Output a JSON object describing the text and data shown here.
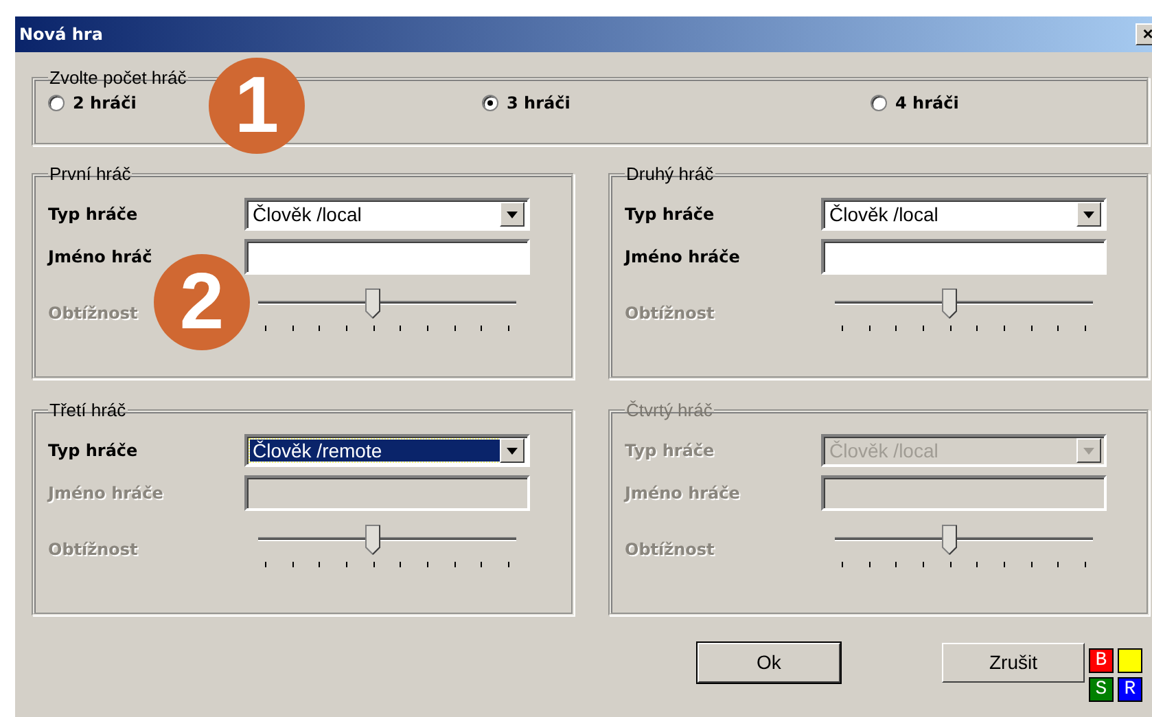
{
  "window": {
    "title": "Nová hra",
    "close": "×"
  },
  "player_count": {
    "title": "Zvolte počet hráč",
    "options": [
      {
        "label": "2 hráči",
        "selected": false
      },
      {
        "label": "3 hráči",
        "selected": true
      },
      {
        "label": "4 hráči",
        "selected": false
      }
    ]
  },
  "players": [
    {
      "title": "První hráč",
      "disabled": false,
      "type": {
        "label": "Typ hráče",
        "value": "Člověk /local",
        "highlighted": false,
        "disabled": false
      },
      "name": {
        "label": "Jméno hráč",
        "disabled": false
      },
      "difficulty": {
        "label": "Obtížnost",
        "disabled": true,
        "level": 0.44
      }
    },
    {
      "title": "Druhý hráč",
      "disabled": false,
      "type": {
        "label": "Typ hráče",
        "value": "Člověk /local",
        "highlighted": false,
        "disabled": false
      },
      "name": {
        "label": "Jméno hráče",
        "disabled": false
      },
      "difficulty": {
        "label": "Obtížnost",
        "disabled": true,
        "level": 0.44
      }
    },
    {
      "title": "Třetí hráč",
      "disabled": false,
      "type": {
        "label": "Typ hráče",
        "value": "Člověk /remote",
        "highlighted": true,
        "disabled": false
      },
      "name": {
        "label": "Jméno hráče",
        "disabled": true
      },
      "difficulty": {
        "label": "Obtížnost",
        "disabled": true,
        "level": 0.44
      }
    },
    {
      "title": "Čtvrtý hráč",
      "disabled": true,
      "type": {
        "label": "Typ hráče",
        "value": "Člověk /local",
        "highlighted": false,
        "disabled": true
      },
      "name": {
        "label": "Jméno hráče",
        "disabled": true
      },
      "difficulty": {
        "label": "Obtížnost",
        "disabled": true,
        "level": 0.44
      }
    }
  ],
  "buttons": [
    {
      "label": "Ok",
      "default": true
    },
    {
      "label": "Zrušit",
      "default": false
    }
  ],
  "logo_tiles": [
    {
      "letter": "B",
      "color": "#ff0000"
    },
    {
      "color": "#ffff00"
    },
    {
      "letter": "S",
      "color": "#008000"
    },
    {
      "letter": "R",
      "color": "#0000ff"
    }
  ],
  "callouts": [
    {
      "number": "1"
    },
    {
      "number": "2"
    }
  ]
}
